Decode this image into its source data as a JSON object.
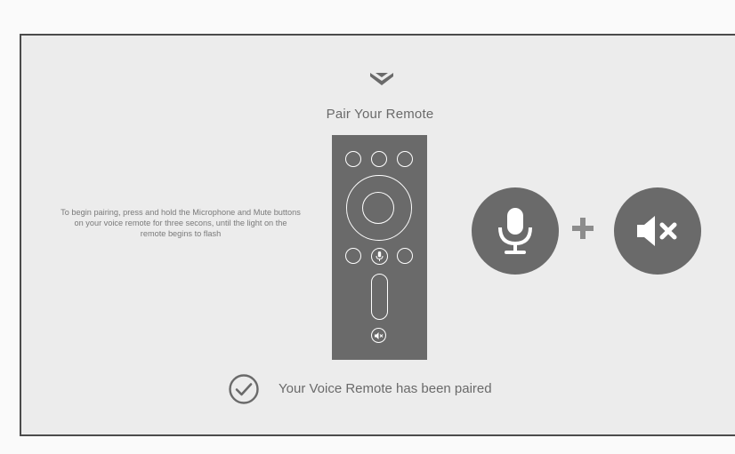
{
  "dialog": {
    "title": "Pair Your Remote",
    "instructions": "To begin pairing, press and hold the Microphone and Mute buttons on your voice remote for three secons, until the light on the remote begins to flash",
    "plus_symbol": "+",
    "status_message": "Your Voice Remote has been paired"
  },
  "icons": {
    "logo": "chevron-v-logo",
    "microphone": "microphone-icon",
    "mute": "speaker-mute-icon",
    "check": "check-circle-icon"
  },
  "colors": {
    "panel_background": "#ececec",
    "border": "#4b4b4b",
    "icon_fill": "#6a6a6a",
    "text": "#6a6a6a",
    "plus": "#8c8c8c"
  }
}
